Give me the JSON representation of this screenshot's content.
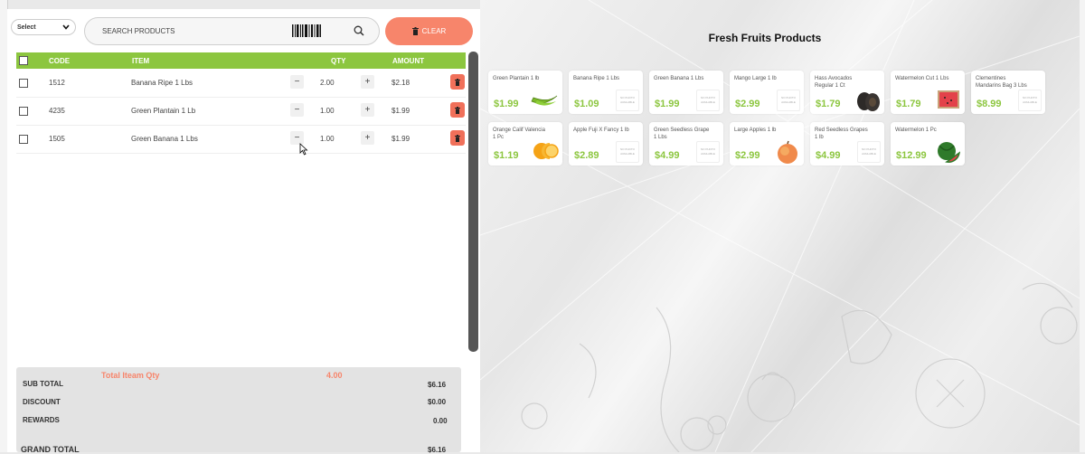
{
  "select": {
    "label": "Select"
  },
  "search": {
    "placeholder": "SEARCH PRODUCTS"
  },
  "clear_button": {
    "label": "CLEAR"
  },
  "table": {
    "headers": {
      "code": "CODE",
      "item": "ITEM",
      "qty": "QTY",
      "amount": "AMOUNT"
    },
    "rows": [
      {
        "code": "1512",
        "item": "Banana Ripe 1 Lbs",
        "qty": "2.00",
        "amount": "$2.18"
      },
      {
        "code": "4235",
        "item": "Green Plantain 1 Lb",
        "qty": "1.00",
        "amount": "$1.99"
      },
      {
        "code": "1505",
        "item": "Green Banana 1 Lbs",
        "qty": "1.00",
        "amount": "$1.99"
      }
    ],
    "minus": "−",
    "plus": "+"
  },
  "summary": {
    "total_qty_label": "Total Iteam Qty",
    "total_qty_value": "4.00",
    "sub_total_label": "SUB TOTAL",
    "sub_total_value": "$6.16",
    "discount_label": "DISCOUNT",
    "discount_value": "$0.00",
    "rewards_label": "REWARDS",
    "rewards_value": "0.00",
    "grand_total_label": "GRAND TOTAL",
    "grand_total_value": "$6.16"
  },
  "products": {
    "title": "Fresh Fruits Products",
    "no_photo": "NO PHOTO AVAILABLE",
    "items": [
      {
        "name": "Green Plantain 1 lb",
        "price": "$1.99",
        "image": "plantain-icon"
      },
      {
        "name": "Banana Ripe 1 Lbs",
        "price": "$1.09",
        "image": "no-photo"
      },
      {
        "name": "Green Banana 1 Lbs",
        "price": "$1.99",
        "image": "no-photo"
      },
      {
        "name": "Mango Large 1 lb",
        "price": "$2.99",
        "image": "no-photo"
      },
      {
        "name": "Hass Avocados Regular 1 Ct",
        "price": "$1.79",
        "image": "avocado-icon"
      },
      {
        "name": "Watermelon Cut 1 Lbs",
        "price": "$1.79",
        "image": "watermelon-cut-icon"
      },
      {
        "name": "Clementines Mandarins Bag 3 Lbs",
        "price": "$8.99",
        "image": "no-photo"
      },
      {
        "name": "Orange Calif Valencia 1 Pc",
        "price": "$1.19",
        "image": "orange-icon"
      },
      {
        "name": "Apple Fuji X Fancy 1 lb",
        "price": "$2.89",
        "image": "no-photo"
      },
      {
        "name": "Green Seedless Grape 1 Lbs",
        "price": "$4.99",
        "image": "no-photo"
      },
      {
        "name": "Large Apples 1 lb",
        "price": "$2.99",
        "image": "apple-icon"
      },
      {
        "name": "Red Seedless Grapes 1 lb",
        "price": "$4.99",
        "image": "no-photo"
      },
      {
        "name": "Watermelon 1 Pc",
        "price": "$12.99",
        "image": "watermelon-icon"
      }
    ]
  },
  "colors": {
    "accent_green": "#8cc63f",
    "accent_orange": "#f7856b",
    "delete_red": "#f0705a"
  }
}
